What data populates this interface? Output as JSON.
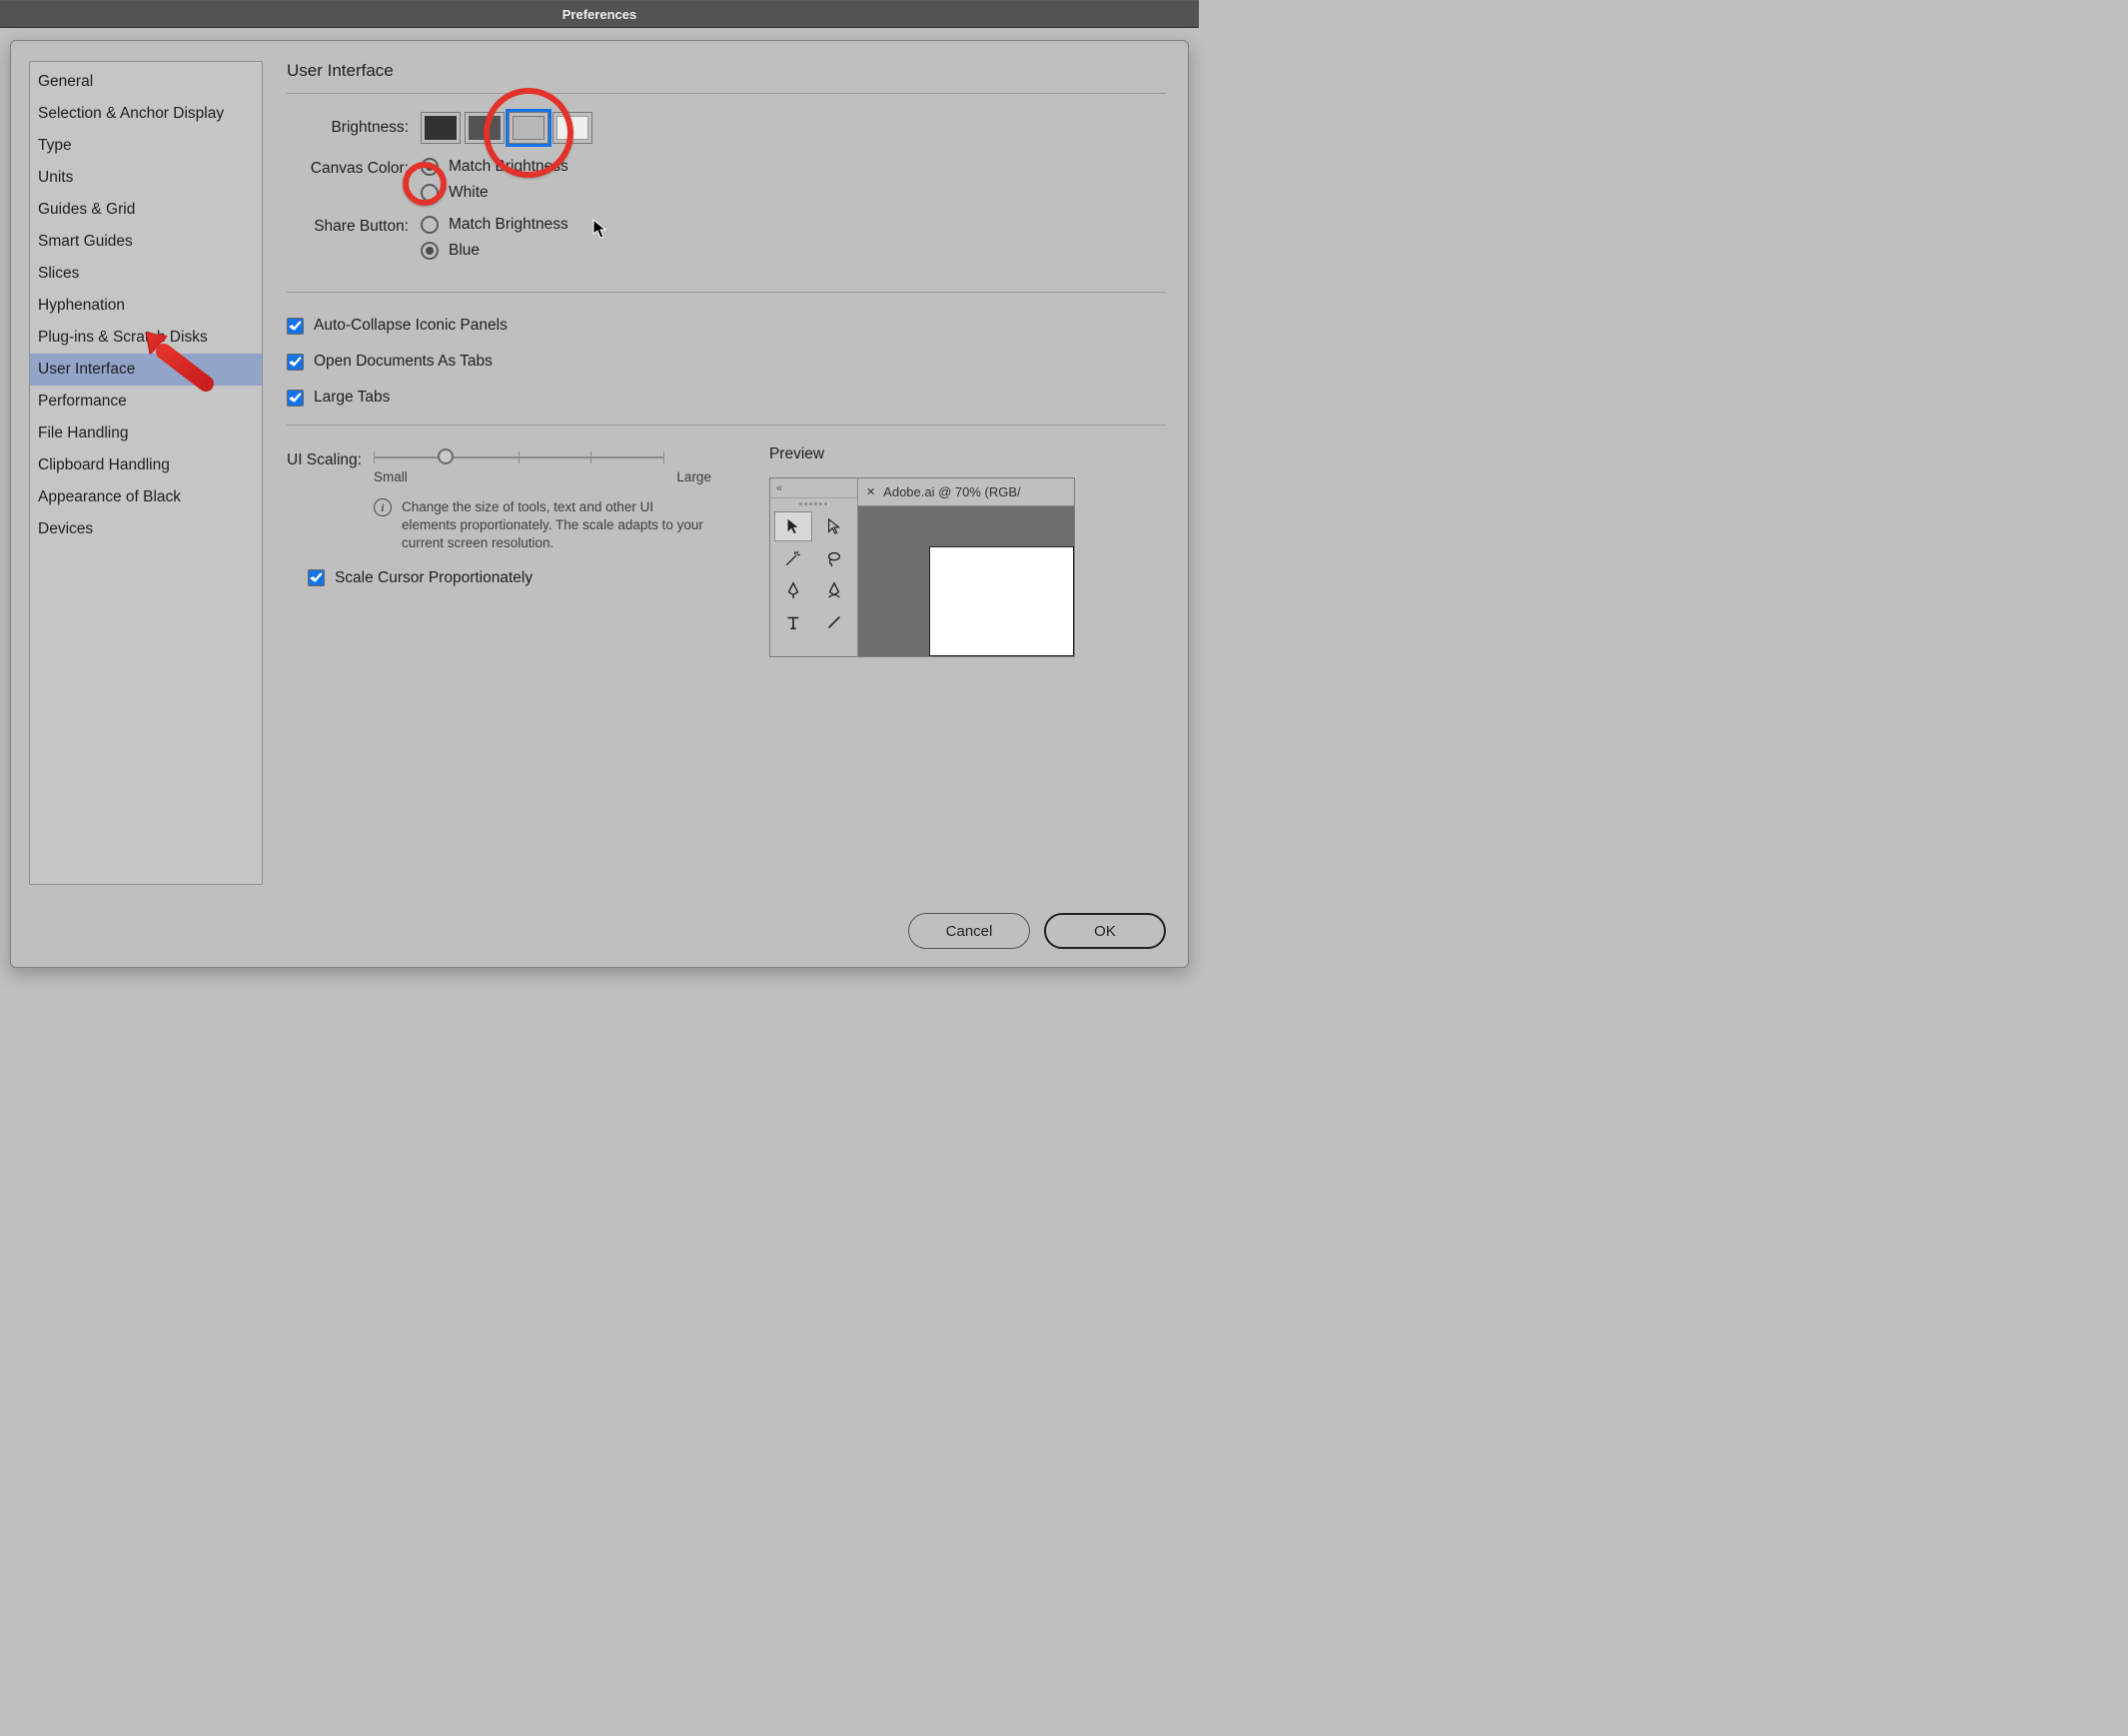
{
  "window": {
    "title": "Preferences"
  },
  "sidebar": {
    "items": [
      "General",
      "Selection & Anchor Display",
      "Type",
      "Units",
      "Guides & Grid",
      "Smart Guides",
      "Slices",
      "Hyphenation",
      "Plug-ins & Scratch Disks",
      "User Interface",
      "Performance",
      "File Handling",
      "Clipboard Handling",
      "Appearance of Black",
      "Devices"
    ],
    "selected_index": 9
  },
  "main": {
    "title": "User Interface",
    "brightness": {
      "label": "Brightness:",
      "options": [
        "Dark",
        "Medium Dark",
        "Medium Light",
        "Light"
      ],
      "selected_index": 2
    },
    "canvas_color": {
      "label": "Canvas Color:",
      "options": [
        "Match Brightness",
        "White"
      ],
      "selected_index": 0
    },
    "share_button": {
      "label": "Share Button:",
      "options": [
        "Match Brightness",
        "Blue"
      ],
      "selected_index": 1
    },
    "checks": {
      "auto_collapse": {
        "label": "Auto-Collapse Iconic Panels",
        "checked": true
      },
      "open_as_tabs": {
        "label": "Open Documents As Tabs",
        "checked": true
      },
      "large_tabs": {
        "label": "Large Tabs",
        "checked": true
      }
    },
    "ui_scaling": {
      "label": "UI Scaling:",
      "min_label": "Small",
      "max_label": "Large",
      "ticks": 5,
      "value_index": 1,
      "info": "Change the size of tools, text and other UI elements proportionately. The scale adapts to your current screen resolution.",
      "scale_cursor": {
        "label": "Scale Cursor Proportionately",
        "checked": true
      }
    },
    "preview": {
      "label": "Preview",
      "collapse_glyph": "«",
      "doc_tab": "Adobe.ai @ 70% (RGB/",
      "close_glyph": "✕"
    }
  },
  "footer": {
    "cancel": "Cancel",
    "ok": "OK"
  },
  "annotations": {
    "circle_brightness": true,
    "circle_canvas_radio": true,
    "arrow_to_sidebar": true
  }
}
